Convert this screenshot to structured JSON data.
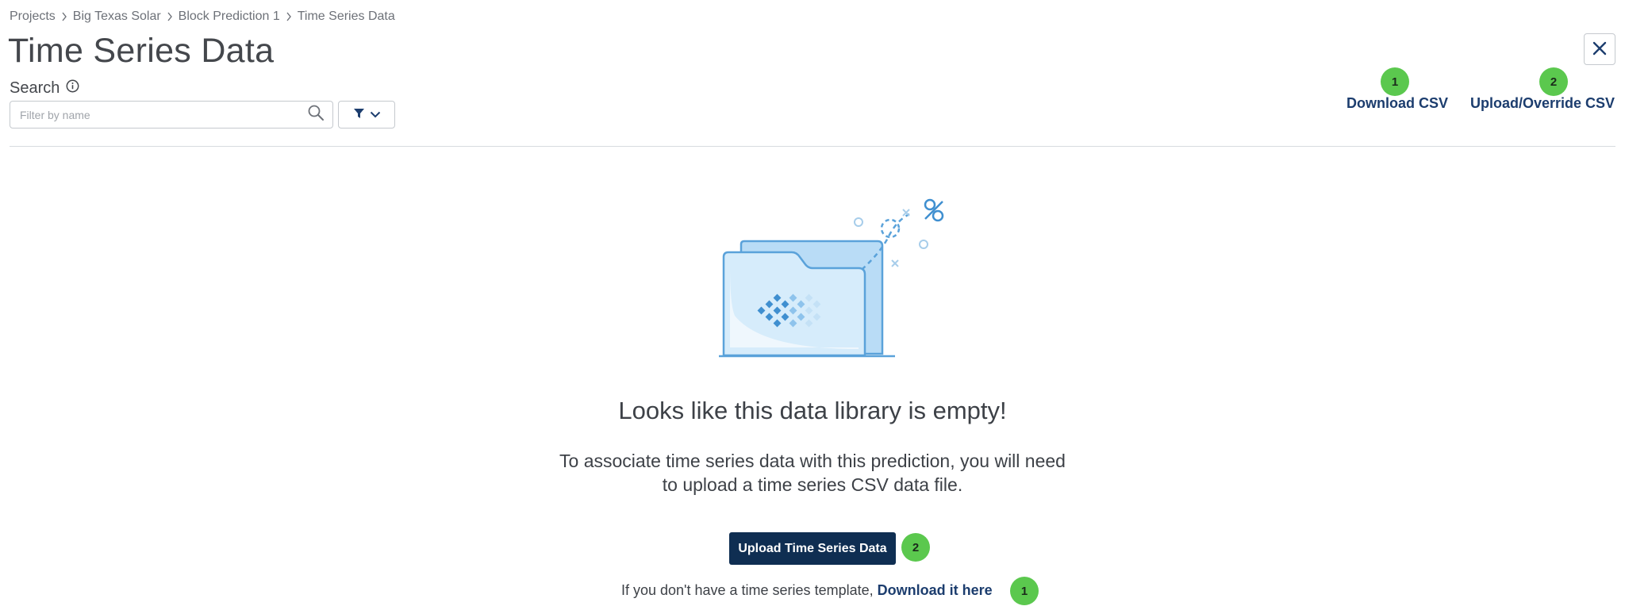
{
  "breadcrumb": {
    "items": [
      "Projects",
      "Big Texas Solar",
      "Block Prediction 1"
    ],
    "current": "Time Series Data"
  },
  "page": {
    "title": "Time Series Data"
  },
  "search": {
    "label": "Search",
    "placeholder": "Filter by name",
    "value": ""
  },
  "actions": {
    "download_csv": {
      "label": "Download CSV",
      "badge": "1"
    },
    "upload_csv": {
      "label": "Upload/Override CSV",
      "badge": "2"
    }
  },
  "empty_state": {
    "heading": "Looks like this data library is empty!",
    "description": "To associate time series data with this prediction, you will need to upload a time series CSV data file.",
    "upload_button": {
      "label": "Upload Time Series Data",
      "badge": "2"
    },
    "template_text": "If you don't have a time series template,",
    "template_link": {
      "label": "Download it here",
      "badge": "1"
    }
  },
  "icons": {
    "close": "close-icon",
    "info": "info-icon",
    "search": "search-icon",
    "filter": "filter-icon",
    "chevron": "chevron-down-icon",
    "breadcrumb_separator": "chevron-right-icon"
  },
  "colors": {
    "primary": "#0f2e52",
    "link": "#1c3d6e",
    "badge": "#5bc84e",
    "illustration": "#5aa2da"
  }
}
